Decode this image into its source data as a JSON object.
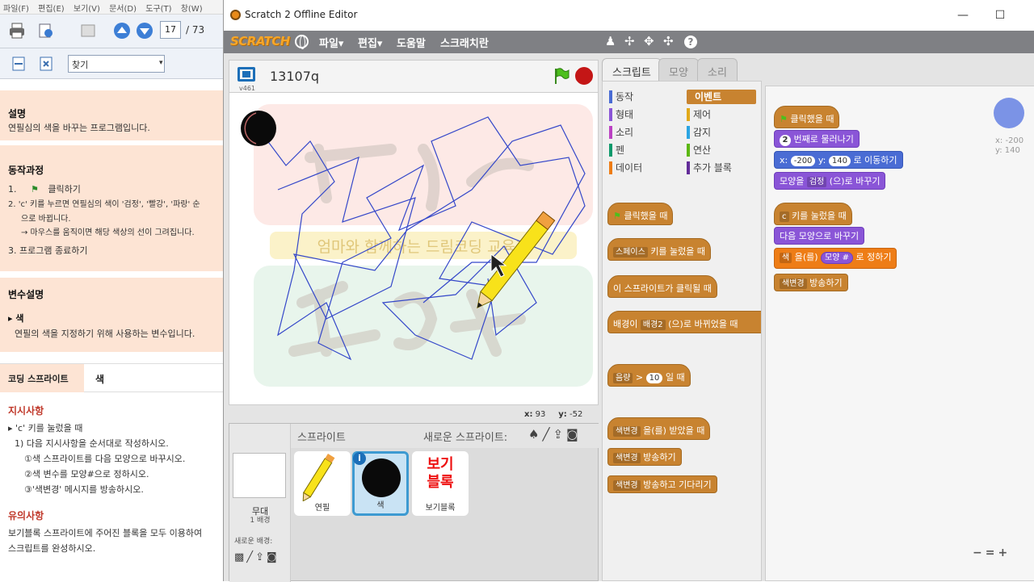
{
  "pdf": {
    "menu": [
      "파일(F)",
      "편집(E)",
      "보기(V)",
      "문서(D)",
      "도구(T)",
      "창(W)"
    ],
    "page_current": "17",
    "page_total": "/ 73",
    "search_placeholder": "찾기",
    "desc_title": "설명",
    "desc_text": "연필심의 색을 바꾸는 프로그램입니다.",
    "process_title": "동작과정",
    "step1": "1.",
    "step1_text": "클릭하기",
    "step2": "2. 'c' 키를 누르면 연필심의 색이 '검정', '빨강', '파랑' 순",
    "step2b": "으로 바뀝니다.",
    "step2c": "→ 마우스를 움직이면 해당 색상의 선이 그려집니다.",
    "step3": "3.  프로그램 종료하기",
    "var_title": "변수설명",
    "var_name": "▸ 색",
    "var_text": "연필의 색을 지정하기 위해 사용하는 변수입니다.",
    "coding_sprite_label": "코딩 스프라이트",
    "coding_sprite_value": "색",
    "instr_title": "지시사항",
    "instr1": "▸ 'c' 키를 눌렀을 때",
    "instr2": "1) 다음 지시사항을 순서대로 작성하시오.",
    "instr3": "①색 스프라이트를 다음 모양으로 바꾸시오.",
    "instr4": "②색 변수를 모양#으로 정하시오.",
    "instr5": "③'색변경' 메시지를 방송하시오.",
    "note_title": "유의사항",
    "note1": "보기블록 스프라이트에 주어진 블록을 모두 이용하여",
    "note2": "스크립트를 완성하시오."
  },
  "window": {
    "title": "Scratch 2 Offline Editor",
    "minimize": "—",
    "maximize": "☐",
    "close": "✕"
  },
  "menubar": {
    "logo": "SCRATCH",
    "file": "파일▾",
    "edit": "편집▾",
    "help": "도움말",
    "tips": "스크래치란"
  },
  "stage": {
    "version": "v461",
    "project_title": "13107q",
    "coord_x_label": "x:",
    "coord_x": "93",
    "coord_y_label": "y:",
    "coord_y": "-52",
    "watermark_banner": "엄마와 함께하는 드림코딩 교육가"
  },
  "sprites": {
    "stage_label": "무대",
    "stage_sub": "1 배경",
    "new_bg_label": "새로운 배경:",
    "title": "스프라이트",
    "new_sprite_label": "새로운 스프라이트:",
    "items": [
      {
        "label": "연필"
      },
      {
        "label": "색"
      },
      {
        "label": "보기블록",
        "thumb": "보기\n블록"
      }
    ]
  },
  "tabs": [
    "스크립트",
    "모양",
    "소리"
  ],
  "categories": [
    {
      "label": "동작",
      "color": "#4a6cd4"
    },
    {
      "label": "형태",
      "color": "#8a55d7"
    },
    {
      "label": "소리",
      "color": "#bb42c3"
    },
    {
      "label": "펜",
      "color": "#0e9a6c"
    },
    {
      "label": "데이터",
      "color": "#ee7d16"
    },
    {
      "label": "이벤트",
      "color": "#c88330"
    },
    {
      "label": "제어",
      "color": "#e1a91a"
    },
    {
      "label": "감지",
      "color": "#2ca5e2"
    },
    {
      "label": "연산",
      "color": "#5cb712"
    },
    {
      "label": "추가 블록",
      "color": "#632d99"
    }
  ],
  "palette_blocks": {
    "b1": "클릭했을 때",
    "b2_dd": "스페이스",
    "b2": "키를 눌렀을 때",
    "b3": "이 스프라이트가 클릭될 때",
    "b4a": "배경이",
    "b4_dd": "배경2",
    "b4b": "(으)로 바뀌었을 때",
    "b5_dd": "음량",
    "b5a": ">",
    "b5_val": "10",
    "b5b": "일 때",
    "b6_dd": "색변경",
    "b6": "을(를) 받았을 때",
    "b7_dd": "색변경",
    "b7": "방송하기",
    "b8_dd": "색변경",
    "b8": "방송하고 기다리기"
  },
  "script_blocks": {
    "s1": "클릭했을 때",
    "s2_val": "2",
    "s2": "번째로 물러나기",
    "s3a": "x:",
    "s3_x": "-200",
    "s3b": "y:",
    "s3_y": "140",
    "s3c": "로 이동하기",
    "s4a": "모양을",
    "s4_dd": "검정",
    "s4b": "(으)로 바꾸기",
    "s5_dd": "c",
    "s5": "키를 눌렀을 때",
    "s6": "다음 모양으로 바꾸기",
    "s7_dd": "색",
    "s7a": "을(를)",
    "s7_val": "모양 #",
    "s7b": "로 정하기",
    "s8_dd": "색변경",
    "s8": "방송하기"
  },
  "sprite_info": {
    "x": "x: -200",
    "y": "y: 140"
  },
  "zoom": {
    "out": "−",
    "reset": "=",
    "in": "+"
  }
}
